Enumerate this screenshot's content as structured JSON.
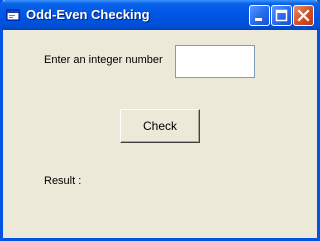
{
  "window": {
    "title": "Odd-Even Checking",
    "controls": {
      "minimize": "minimize-icon",
      "maximize": "maximize-icon",
      "close": "close-icon"
    },
    "icon": "app-icon"
  },
  "form": {
    "prompt_label": "Enter an integer number",
    "input_value": "",
    "check_button_label": "Check",
    "result_label": "Result :"
  },
  "colors": {
    "titlebar": "#0055e5",
    "close_button": "#d3522c",
    "face": "#ece9d8"
  }
}
